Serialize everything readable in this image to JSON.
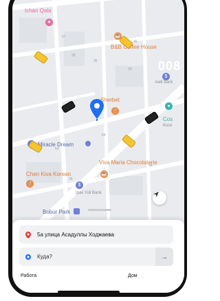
{
  "map": {
    "pois": [
      {
        "id": "ichan-qala",
        "label": "Ichan Qala",
        "color": "#e96ba0"
      },
      {
        "id": "bnb-coffee",
        "label": "B&B Coffee House",
        "color": "#e07b39"
      },
      {
        "id": "sherbet",
        "label": "Sherbet",
        "color": "#e07b39"
      },
      {
        "id": "miracle-dream",
        "label": "Miracle Dream",
        "color": "#5566aa"
      },
      {
        "id": "chen-kiva",
        "label": "Chen Kiva Korean",
        "color": "#e07b39"
      },
      {
        "id": "viva-maria",
        "label": "Viva Maria Chocolaterie",
        "color": "#e07b39"
      },
      {
        "id": "bobur-park",
        "label": "Bobur Park",
        "color": "#5566aa"
      },
      {
        "id": "ipak-yoli",
        "label": "Ipak Yoli Bank",
        "color": "#8a8f96"
      },
      {
        "id": "kalit-bank",
        "label": "kalit bank",
        "color": "#8a8f96"
      },
      {
        "id": "cos",
        "label": "Cos",
        "color": "#3ab3ad"
      },
      {
        "id": "cos-sub",
        "label": "Коси",
        "color": "#8a8f96"
      }
    ],
    "street_numbers": [
      "57",
      "28",
      "26",
      "46",
      "29",
      "64",
      "54",
      "28",
      "54"
    ],
    "big_numbers": "008"
  },
  "form": {
    "from_address": "5a улица Асадуллы Ходжаева",
    "to_placeholder": "Куда?",
    "go_arrow": "→"
  },
  "shortcuts": {
    "work": "Работа",
    "home": "Дом"
  }
}
